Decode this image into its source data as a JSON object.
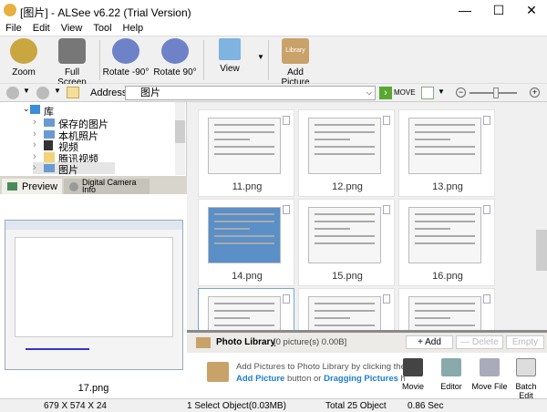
{
  "window": {
    "title": "[图片] - ALSee v6.22 (Trial Version)",
    "minimize": "—",
    "maximize": "☐",
    "close": "✕"
  },
  "menu": [
    "File",
    "Edit",
    "View",
    "Tool",
    "Help"
  ],
  "toolbar": {
    "zoom": "Zoom",
    "fullscreen": "Full Screen",
    "rotate_left": "Rotate -90°",
    "rotate_right": "Rotate 90°",
    "view": "View",
    "add_picture": "Add Picture",
    "library_badge": "Library"
  },
  "address": {
    "label": "Address",
    "value": "图片",
    "move": "MOVE"
  },
  "tree": [
    "库",
    "保存的图片",
    "本机照片",
    "视频",
    "腾讯视频",
    "图片"
  ],
  "tabs": {
    "preview": "Preview",
    "camera_info": "Digital Camera Info"
  },
  "preview": {
    "filename": "17.png"
  },
  "thumbnails": [
    "11.png",
    "12.png",
    "13.png",
    "14.png",
    "15.png",
    "16.png",
    "",
    "",
    ""
  ],
  "library": {
    "title": "Photo Library",
    "count": "[0 picture(s) 0.00B]",
    "add": "+ Add",
    "delete": "— Delete",
    "empty": "Empty",
    "hint1": "Add Pictures to Photo Library by clicking the",
    "hint_link1": "Add Picture",
    "hint_mid": " button or ",
    "hint_link2": "Dragging Pictures",
    "hint_end": " h",
    "actions": [
      "Movie",
      "Editor",
      "Move File",
      "Batch Edit"
    ]
  },
  "status": {
    "dims": "679 X 574 X 24",
    "selection": "1 Select Object(0.03MB)",
    "total": "Total 25 Object",
    "time": "0.86 Sec"
  },
  "colors": {
    "link": "#1a7fd0",
    "accent": "#3c8fd8"
  }
}
